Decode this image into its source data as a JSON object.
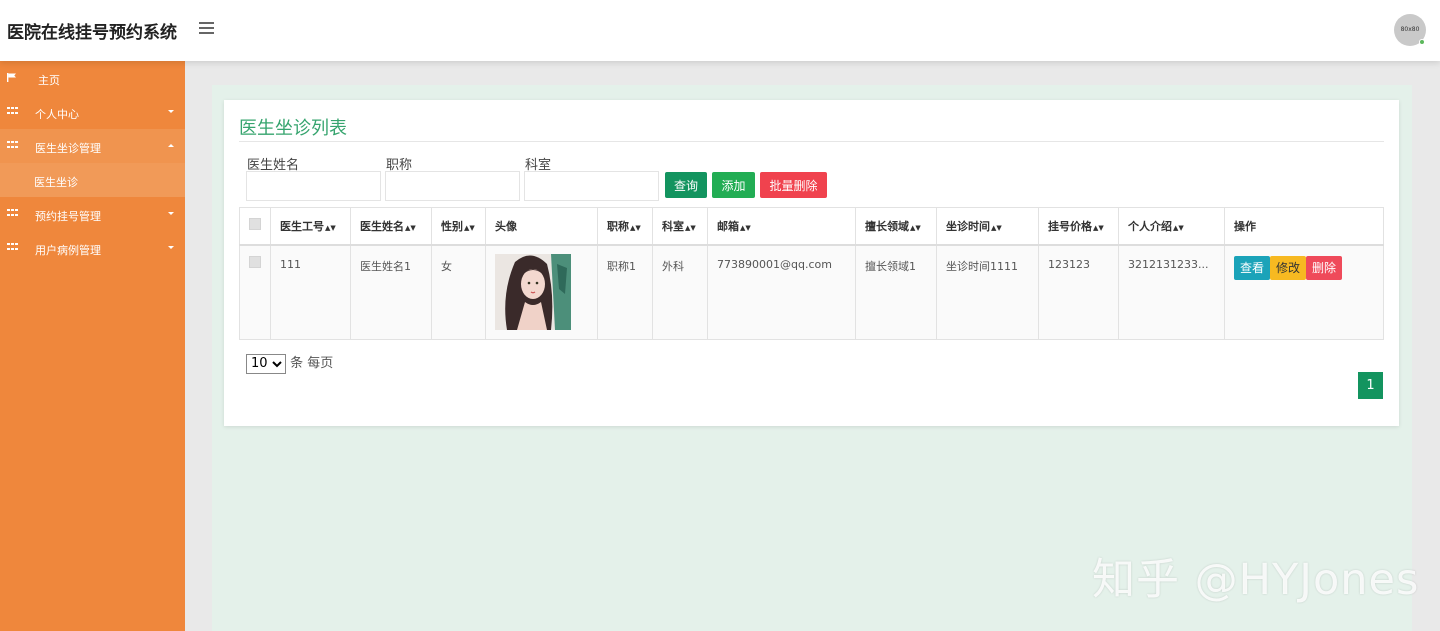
{
  "header": {
    "app_title": "医院在线挂号预约系统",
    "avatar_text": "80x80"
  },
  "sidebar": {
    "items": [
      {
        "label": "主页",
        "icon": "flag-icon"
      },
      {
        "label": "个人中心",
        "icon": "grid-icon"
      },
      {
        "label": "医生坐诊管理",
        "icon": "grid-icon"
      },
      {
        "label": "医生坐诊",
        "icon": ""
      },
      {
        "label": "预约挂号管理",
        "icon": "grid-icon"
      },
      {
        "label": "用户病例管理",
        "icon": "grid-icon"
      }
    ]
  },
  "main": {
    "title": "医生坐诊列表",
    "filters": {
      "name_label": "医生姓名",
      "title_label": "职称",
      "dept_label": "科室",
      "name_value": "",
      "title_value": "",
      "dept_value": ""
    },
    "buttons": {
      "query": "查询",
      "add": "添加",
      "batch_delete": "批量删除"
    },
    "table": {
      "headers": [
        "医生工号",
        "医生姓名",
        "性别",
        "头像",
        "职称",
        "科室",
        "邮箱",
        "擅长领域",
        "坐诊时间",
        "挂号价格",
        "个人介绍",
        "操作"
      ],
      "rows": [
        {
          "id": "111",
          "name": "医生姓名1",
          "gender": "女",
          "title": "职称1",
          "dept": "外科",
          "email": "773890001@qq.com",
          "expertise": "擅长领域1",
          "schedule": "坐诊时间1111",
          "price": "123123",
          "intro": "3212131233...",
          "actions": {
            "view": "查看",
            "edit": "修改",
            "delete": "删除"
          }
        }
      ]
    },
    "pagination": {
      "page_size": "10",
      "page_size_suffix": "条 每页",
      "current_page": "1"
    }
  },
  "watermark": "知乎 @HYJones",
  "colors": {
    "sidebar": "#ef873c",
    "primary_green": "#13945f",
    "add_green": "#22ad54",
    "danger_red": "#f0424e",
    "info_teal": "#1ba3b9",
    "warning_yellow": "#f7b921"
  }
}
